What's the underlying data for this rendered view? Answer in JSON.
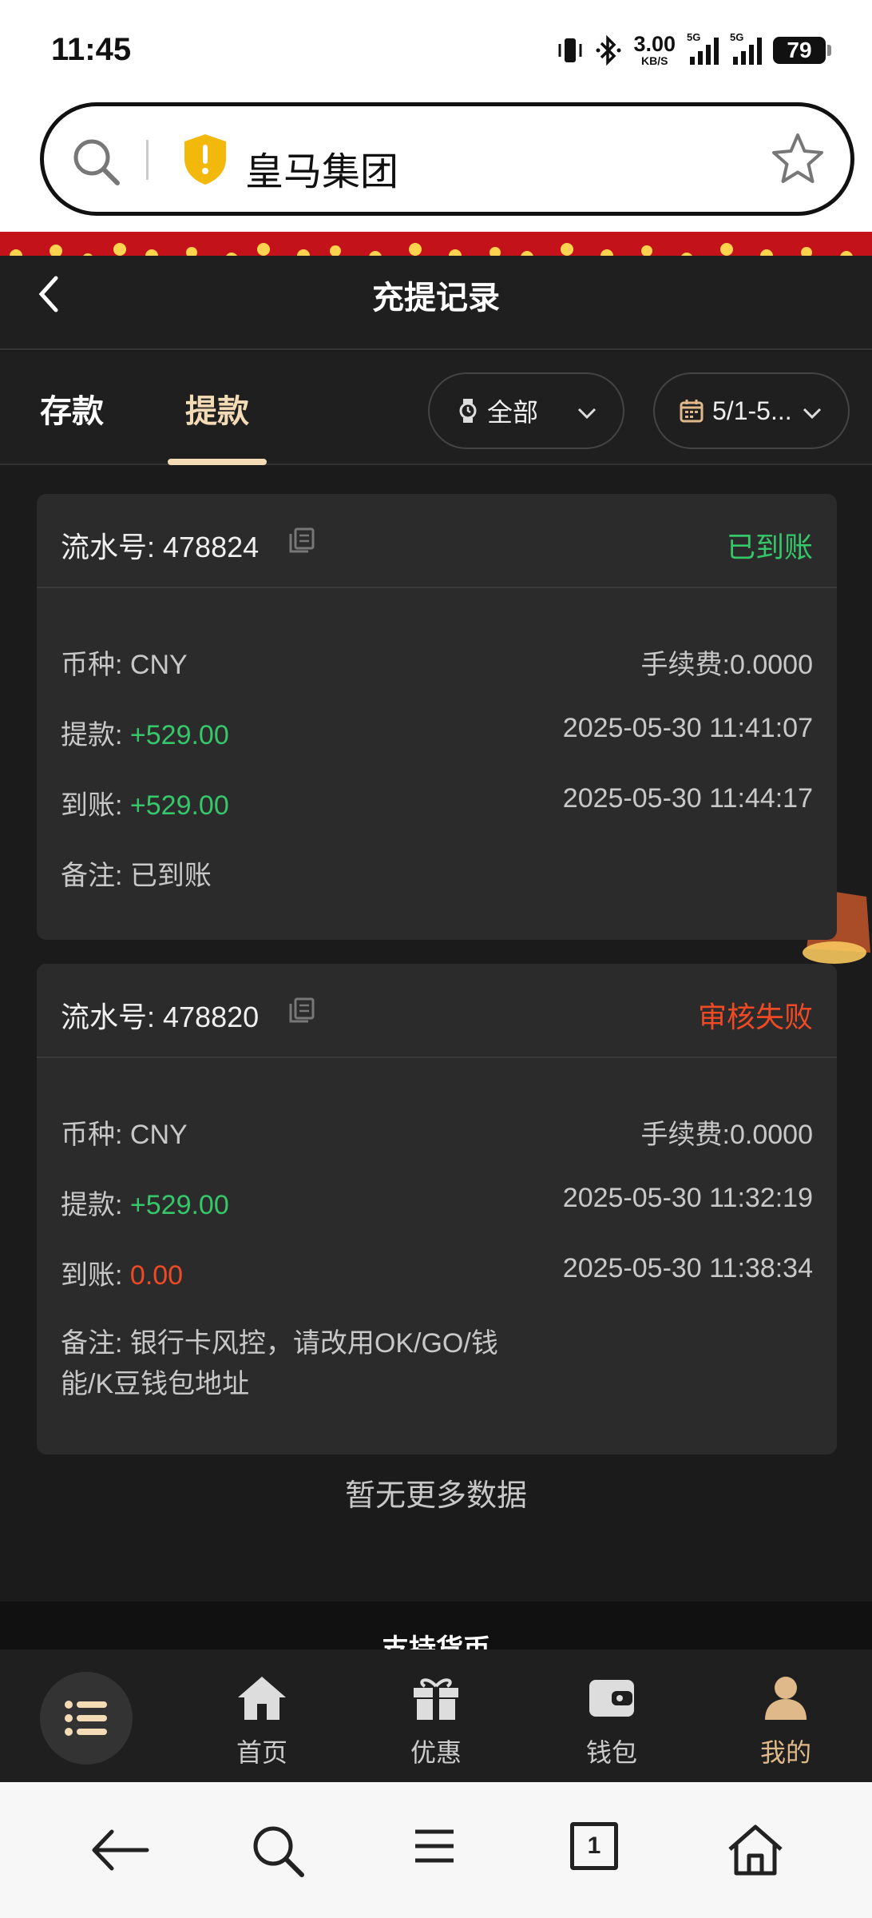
{
  "status_bar": {
    "time": "11:45",
    "net_speed": "3.00",
    "net_unit": "KB/S",
    "signal1_tag": "5G",
    "signal2_tag": "5G",
    "battery": "79"
  },
  "browser": {
    "address_text": "皇马集团",
    "icons": [
      "search-icon",
      "shield-warning-icon",
      "star-icon"
    ]
  },
  "header": {
    "title": "充提记录"
  },
  "tabs": {
    "deposit": "存款",
    "withdraw": "提款",
    "active": "withdraw"
  },
  "filters": {
    "type_value": "全部",
    "date_value": "5/1-5..."
  },
  "records": [
    {
      "serial_label": "流水号: ",
      "serial": "478824",
      "status": "已到账",
      "status_color": "#35c76a",
      "currency_label": "币种: ",
      "currency": "CNY",
      "fee_label": "手续费:",
      "fee": "0.0000",
      "withdraw_label": "提款: ",
      "withdraw_amount": "+529.00",
      "withdraw_time": "2025-05-30 11:41:07",
      "arrive_label": "到账: ",
      "arrive_amount": "+529.00",
      "arrive_time": "2025-05-30 11:44:17",
      "note_label": "备注: ",
      "note": "已到账"
    },
    {
      "serial_label": "流水号: ",
      "serial": "478820",
      "status": "审核失败",
      "status_color": "#ee4a25",
      "currency_label": "币种: ",
      "currency": "CNY",
      "fee_label": "手续费:",
      "fee": "0.0000",
      "withdraw_label": "提款: ",
      "withdraw_amount": "+529.00",
      "withdraw_time": "2025-05-30 11:32:19",
      "arrive_label": "到账: ",
      "arrive_amount": "0.00",
      "arrive_time": "2025-05-30 11:38:34",
      "note_label": "备注: ",
      "note_line1": "银行卡风控，请改用OK/GO/钱",
      "note_line2": "能/K豆钱包地址"
    }
  ],
  "no_more": "暂无更多数据",
  "currency_section": "支持货币",
  "app_nav": {
    "items": [
      {
        "label": "首页",
        "icon": "home-icon"
      },
      {
        "label": "优惠",
        "icon": "gift-icon"
      },
      {
        "label": "钱包",
        "icon": "wallet-icon"
      },
      {
        "label": "我的",
        "icon": "user-icon"
      }
    ],
    "active": "我的"
  },
  "browser_nav": {
    "tab_count": "1",
    "icons": [
      "back-arrow-icon",
      "search-icon",
      "menu-icon",
      "tabs-icon",
      "home-icon"
    ]
  },
  "colors": {
    "accent_gold": "#f3dcb5",
    "success_green": "#35c76a",
    "fail_red": "#ee4a25",
    "festive_red": "#c4121b"
  }
}
